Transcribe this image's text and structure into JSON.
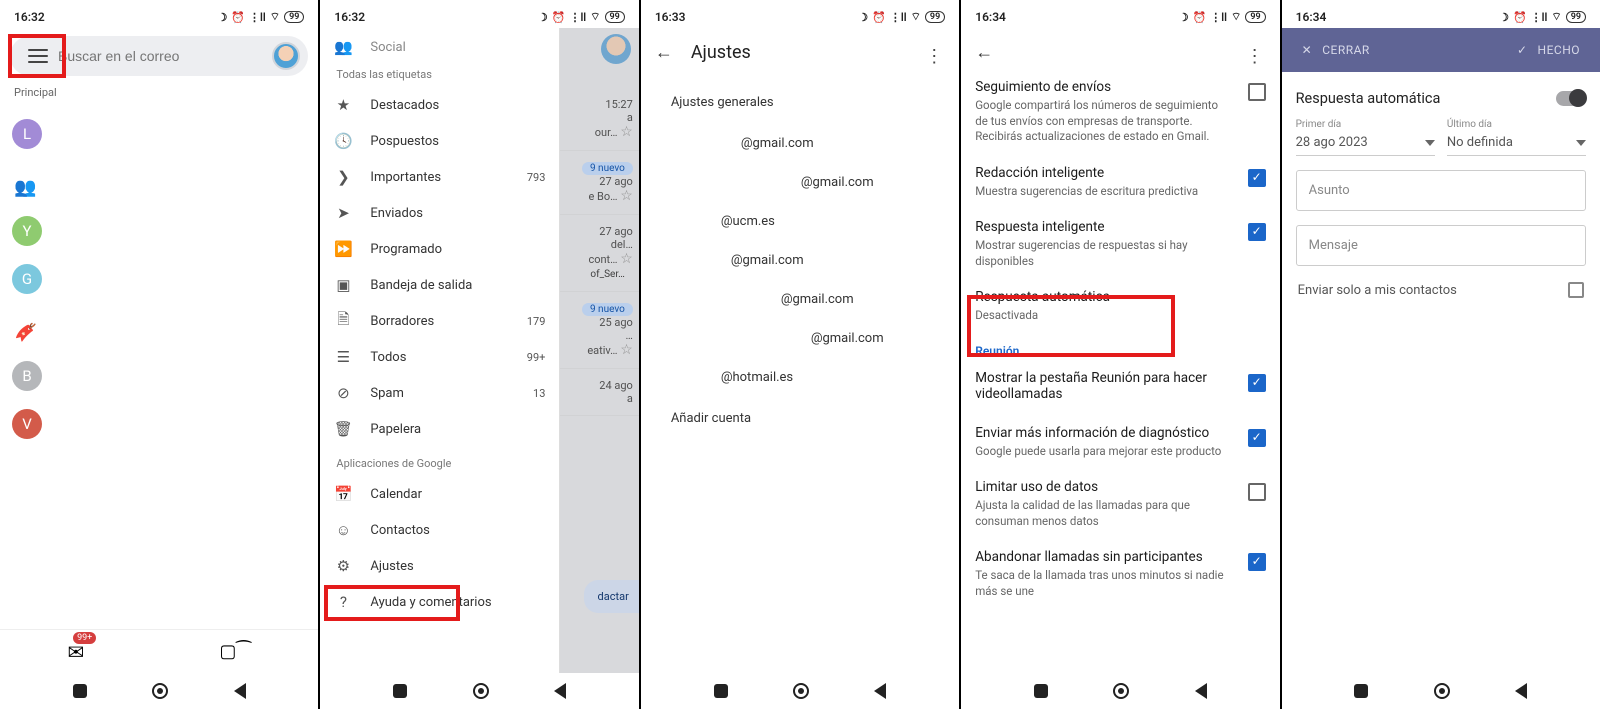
{
  "status": {
    "t1": "16:32",
    "t2": "16:32",
    "t3": "16:33",
    "t4": "16:34",
    "t5": "16:34",
    "batt": "99"
  },
  "s1": {
    "search_placeholder": "Buscar en el correo",
    "tab_label": "Principal",
    "avatars": [
      {
        "letter": "L",
        "color": "#a28bd6"
      },
      {
        "letter": "Y",
        "color": "#8fcb70"
      },
      {
        "letter": "G",
        "color": "#7cc8de"
      },
      {
        "letter": "B",
        "color": "#b5b7ba"
      },
      {
        "letter": "V",
        "color": "#d35b4a"
      }
    ],
    "badge": "99+"
  },
  "s2": {
    "top_tab": "Social",
    "section_all": "Todas las etiquetas",
    "items": [
      {
        "icon": "★",
        "label": "Destacados",
        "count": ""
      },
      {
        "icon": "⏱",
        "label": "Pospuestos",
        "count": ""
      },
      {
        "icon": "❯",
        "label": "Importantes",
        "count": "793"
      },
      {
        "icon": "➤",
        "label": "Enviados",
        "count": ""
      },
      {
        "icon": "⏩",
        "label": "Programado",
        "count": ""
      },
      {
        "icon": "📤",
        "label": "Bandeja de salida",
        "count": ""
      },
      {
        "icon": "📄",
        "label": "Borradores",
        "count": "179"
      },
      {
        "icon": "✉",
        "label": "Todos",
        "count": "99+"
      },
      {
        "icon": "⊘",
        "label": "Spam",
        "count": "13"
      },
      {
        "icon": "🗑",
        "label": "Papelera",
        "count": ""
      }
    ],
    "section_apps": "Aplicaciones de Google",
    "app_items": [
      {
        "icon": "📅",
        "label": "Calendar"
      },
      {
        "icon": "☺",
        "label": "Contactos"
      },
      {
        "icon": "⚙",
        "label": "Ajustes"
      },
      {
        "icon": "?",
        "label": "Ayuda y comentarios"
      }
    ],
    "behind": {
      "r1_time": "15:27",
      "r1_sub": "a",
      "r1_sub2": "our…",
      "r2_chip": "9 nuevo",
      "r2_date": "27 ago",
      "r2_sub": "e Bo…",
      "r3_date": "27 ago",
      "r3_sub": "del…",
      "r3_sub2": "cont…",
      "r3_chip": "of_Ser…",
      "r4_chip": "9 nuevo",
      "r4_date": "25 ago",
      "r4_sub": "…",
      "r4_sub2": "eativ…",
      "r5_date": "24 ago",
      "r5_sub": "a",
      "compose": "dactar"
    }
  },
  "s3": {
    "title": "Ajustes",
    "general": "Ajustes generales",
    "accounts": [
      "@gmail.com",
      "@gmail.com",
      "@ucm.es",
      "@gmail.com",
      "@gmail.com",
      "@gmail.com",
      "@hotmail.es"
    ],
    "add": "Añadir cuenta"
  },
  "s4": {
    "items": [
      {
        "t": "Seguimiento de envíos",
        "d": "Google compartirá los números de seguimiento de tus envíos con empresas de transporte. Recibirás actualizaciones de estado en Gmail.",
        "chk": false
      },
      {
        "t": "Redacción inteligente",
        "d": "Muestra sugerencias de escritura predictiva",
        "chk": true
      },
      {
        "t": "Respuesta inteligente",
        "d": "Mostrar sugerencias de respuestas si hay disponibles",
        "chk": true
      },
      {
        "t": "Respuesta automática",
        "d": "Desactivada",
        "chk": null
      }
    ],
    "section": "Reunión",
    "items2": [
      {
        "t": "Mostrar la pestaña Reunión para hacer videollamadas",
        "d": "",
        "chk": true
      },
      {
        "t": "Enviar más información de diagnóstico",
        "d": "Google puede usarla para mejorar este producto",
        "chk": true
      },
      {
        "t": "Limitar uso de datos",
        "d": "Ajusta la calidad de las llamadas para que consuman menos datos",
        "chk": false
      },
      {
        "t": "Abandonar llamadas sin participantes",
        "d": "Te saca de la llamada tras unos minutos si nadie más se une",
        "chk": true
      }
    ]
  },
  "s5": {
    "close": "CERRAR",
    "done": "HECHO",
    "title": "Respuesta automática",
    "first_label": "Primer día",
    "first_val": "28 ago 2023",
    "last_label": "Último día",
    "last_val": "No definida",
    "subject_ph": "Asunto",
    "message_ph": "Mensaje",
    "contacts_only": "Enviar solo a mis contactos"
  }
}
